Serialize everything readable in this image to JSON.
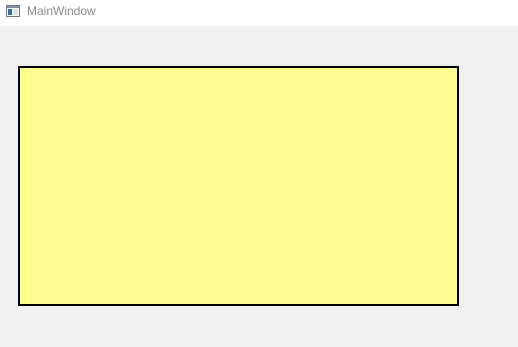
{
  "window": {
    "title": "MainWindow",
    "icon": "app-window-icon"
  },
  "panel": {
    "fill_color": "#ffff8f",
    "border_color": "#000000"
  }
}
